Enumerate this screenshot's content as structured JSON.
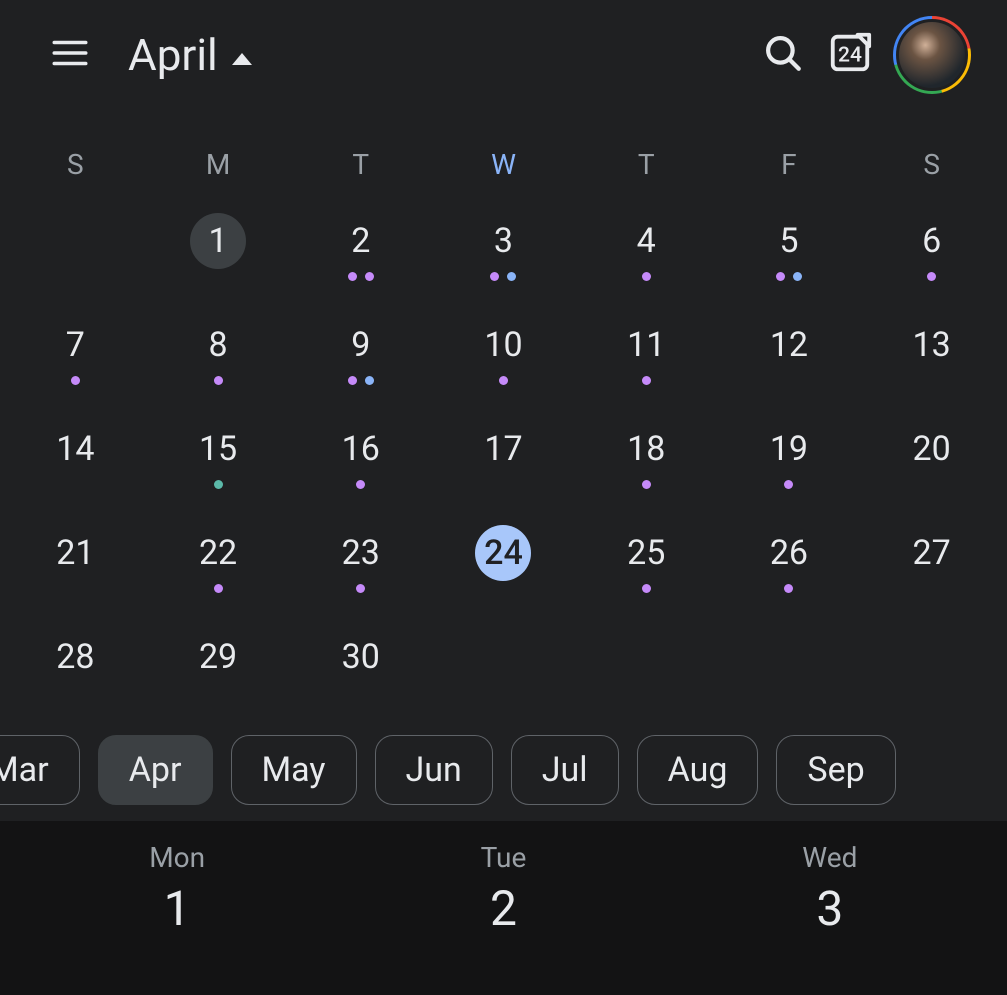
{
  "header": {
    "month_label": "April",
    "today_number": "24"
  },
  "weekdays": [
    "S",
    "M",
    "T",
    "W",
    "T",
    "F",
    "S"
  ],
  "active_weekday_index": 3,
  "month": {
    "rows": 5,
    "cells": [
      {
        "n": "",
        "dots": []
      },
      {
        "n": "1",
        "dots": [],
        "dim": true
      },
      {
        "n": "2",
        "dots": [
          "purple",
          "purple"
        ]
      },
      {
        "n": "3",
        "dots": [
          "purple",
          "blue"
        ]
      },
      {
        "n": "4",
        "dots": [
          "purple"
        ]
      },
      {
        "n": "5",
        "dots": [
          "purple",
          "blue"
        ]
      },
      {
        "n": "6",
        "dots": [
          "purple"
        ]
      },
      {
        "n": "7",
        "dots": [
          "purple"
        ]
      },
      {
        "n": "8",
        "dots": [
          "purple"
        ]
      },
      {
        "n": "9",
        "dots": [
          "purple",
          "blue"
        ]
      },
      {
        "n": "10",
        "dots": [
          "purple"
        ]
      },
      {
        "n": "11",
        "dots": [
          "purple"
        ]
      },
      {
        "n": "12",
        "dots": []
      },
      {
        "n": "13",
        "dots": []
      },
      {
        "n": "14",
        "dots": []
      },
      {
        "n": "15",
        "dots": [
          "teal"
        ]
      },
      {
        "n": "16",
        "dots": [
          "purple"
        ]
      },
      {
        "n": "17",
        "dots": []
      },
      {
        "n": "18",
        "dots": [
          "purple"
        ]
      },
      {
        "n": "19",
        "dots": [
          "purple"
        ]
      },
      {
        "n": "20",
        "dots": []
      },
      {
        "n": "21",
        "dots": []
      },
      {
        "n": "22",
        "dots": [
          "purple"
        ]
      },
      {
        "n": "23",
        "dots": [
          "purple"
        ]
      },
      {
        "n": "24",
        "dots": [],
        "today": true
      },
      {
        "n": "25",
        "dots": [
          "purple"
        ]
      },
      {
        "n": "26",
        "dots": [
          "purple"
        ]
      },
      {
        "n": "27",
        "dots": []
      },
      {
        "n": "28",
        "dots": []
      },
      {
        "n": "29",
        "dots": []
      },
      {
        "n": "30",
        "dots": []
      },
      {
        "n": "",
        "dots": []
      },
      {
        "n": "",
        "dots": []
      },
      {
        "n": "",
        "dots": []
      },
      {
        "n": "",
        "dots": []
      }
    ]
  },
  "chips": [
    {
      "label": "Mar"
    },
    {
      "label": "Apr",
      "active": true
    },
    {
      "label": "May"
    },
    {
      "label": "Jun"
    },
    {
      "label": "Jul"
    },
    {
      "label": "Aug"
    },
    {
      "label": "Sep"
    }
  ],
  "agenda": [
    {
      "dow": "Mon",
      "num": "1"
    },
    {
      "dow": "Tue",
      "num": "2"
    },
    {
      "dow": "Wed",
      "num": "3"
    }
  ],
  "colors": {
    "accent": "#8ab4f8",
    "today_fill": "#a8c7fa",
    "event_purple": "#c58af9",
    "event_blue": "#8ab4f8",
    "event_teal": "#5bb9a9"
  }
}
